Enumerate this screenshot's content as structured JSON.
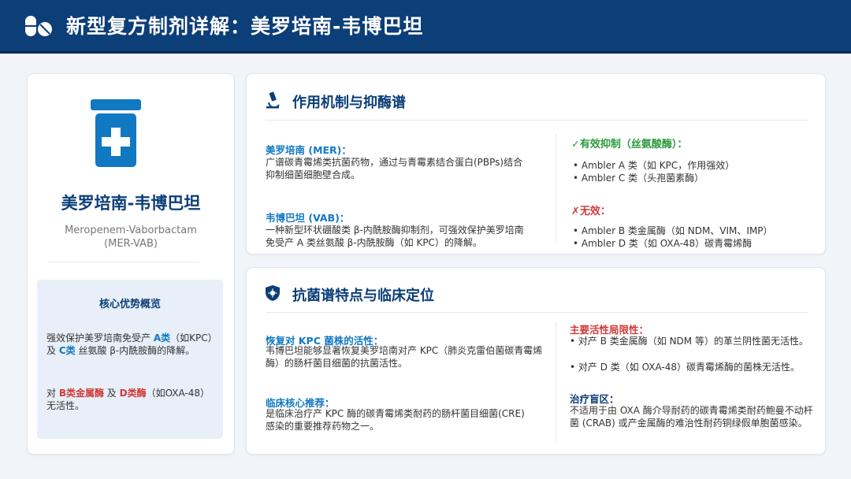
{
  "header": {
    "title": "新型复方制剂详解：美罗培南-韦博巴坦"
  },
  "drug": {
    "name": "美罗培南-韦博巴坦",
    "en_name": "Meropenem-Vaborbactam",
    "abbr": "(MER-VAB)"
  },
  "advantages": {
    "title": "核心优势概览",
    "p1": {
      "t1": "强效保护美罗培南免受产 ",
      "h1": "A类",
      "t2": "（如KPC）及 ",
      "h2": "C类",
      "t3": " 丝氨酸 β-内酰胺酶的降解。"
    },
    "p2": {
      "t1": "对 ",
      "h1": "B类金属酶",
      "t2": " 及 ",
      "h2": "D类酶",
      "t3": "（如OXA-48）无活性。"
    }
  },
  "mechanism": {
    "title": "作用机制与抑酶谱",
    "mer_head": "美罗培南 (MER)：",
    "mer_text": "广谱碳青霉烯类抗菌药物，通过与青霉素结合蛋白(PBPs)结合抑制细菌细胞壁合成。",
    "vab_head": "韦博巴坦 (VAB)：",
    "vab_text": "一种新型环状硼酸类 β-内酰胺酶抑制剂，可强效保护美罗培南免受产 A 类丝氨酸 β-内酰胺酶（如 KPC）的降解。",
    "effective_head": "✓有效抑制（丝氨酸酶）：",
    "effective_items": [
      "• Ambler A 类（如 KPC，作用强效）",
      "• Ambler C 类（头孢菌素酶）"
    ],
    "ineffective_head": "✗无效：",
    "ineffective_items": [
      "• Ambler B 类金属酶（如 NDM、VIM、IMP）",
      "• Ambler D 类（如 OXA-48）碳青霉烯酶"
    ]
  },
  "spectrum": {
    "title": "抗菌谱特点与临床定位",
    "restore_head": "恢复对 KPC 菌株的活性：",
    "restore_text": "韦博巴坦能够显著恢复美罗培南对产 KPC（肺炎克雷伯菌碳青霉烯酶）的肠杆菌目细菌的抗菌活性。",
    "recommend_head": "临床核心推荐：",
    "recommend_text": "是临床治疗产 KPC 酶的碳青霉烯类耐药的肠杆菌目细菌(CRE) 感染的重要推荐药物之一。",
    "limit_head": "主要活性局限性：",
    "limit_items": [
      "• 对产 B 类金属酶（如 NDM 等）的革兰阴性菌无活性。",
      "• 对产 D 类（如 OXA-48）碳青霉烯酶的菌株无活性。"
    ],
    "blind_head": "治疗盲区：",
    "blind_text": "不适用于由 OXA 酶介导耐药的碳青霉烯类耐药鲍曼不动杆菌 (CRAB) 或产金属酶的难治性耐药铜绿假单胞菌感染。"
  },
  "colors": {
    "navy": "#0c3e78",
    "blue": "#1178c2",
    "red": "#d23a3a",
    "green": "#2e9b3f"
  }
}
